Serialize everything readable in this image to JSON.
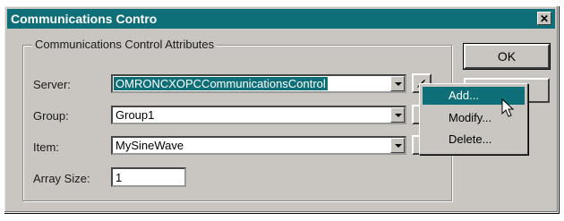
{
  "window": {
    "title": "Communications Contro",
    "close_glyph": "✕"
  },
  "group": {
    "legend": "Communications Control Attributes"
  },
  "fields": {
    "server_label": "Server:",
    "server_value": "OMRONCXOPCCommunicationsControl",
    "group_label": "Group:",
    "group_value": "Group1",
    "item_label": "Item:",
    "item_value": "MySineWave",
    "array_label": "Array Size:",
    "array_value": "1"
  },
  "buttons": {
    "ok_label": "OK"
  },
  "context_menu": {
    "items": [
      "Add...",
      "Modify...",
      "Delete..."
    ],
    "active_index": 0
  },
  "icons": {
    "dropdown": "chevron-down-icon",
    "edit": "edit-icon",
    "cursor": "pointer-cursor-icon"
  },
  "colors": {
    "accent": "#0f6f78",
    "face": "#c9c6c1"
  }
}
